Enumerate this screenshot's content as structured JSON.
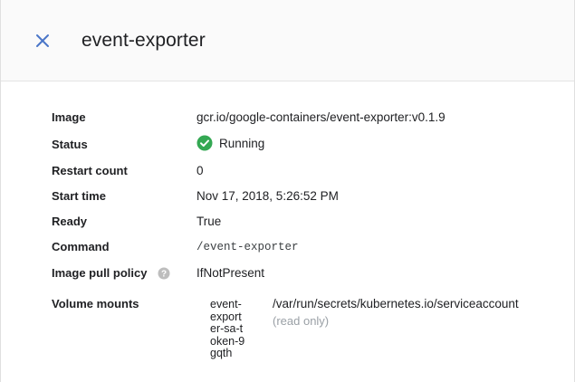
{
  "panel": {
    "title": "event-exporter",
    "close_icon": "close-icon"
  },
  "details": {
    "image": {
      "label": "Image",
      "value": "gcr.io/google-containers/event-exporter:v0.1.9"
    },
    "status": {
      "label": "Status",
      "value": "Running",
      "icon": "check-circle-icon",
      "color": "#34a853"
    },
    "restart_count": {
      "label": "Restart count",
      "value": "0"
    },
    "start_time": {
      "label": "Start time",
      "value": "Nov 17, 2018, 5:26:52 PM"
    },
    "ready": {
      "label": "Ready",
      "value": "True"
    },
    "command": {
      "label": "Command",
      "value": "/event-exporter"
    },
    "image_pull_policy": {
      "label": "Image pull policy",
      "value": "IfNotPresent",
      "help_icon": "help-icon"
    },
    "volume_mounts": {
      "label": "Volume mounts",
      "name_lines": [
        "event-",
        "export",
        "er-sa-t",
        "oken-9",
        "gqth"
      ],
      "path": "/var/run/secrets/kubernetes.io/serviceaccount",
      "note": "(read only)"
    }
  },
  "colors": {
    "accent": "#4285f4",
    "success": "#34a853",
    "muted": "#9aa0a6"
  }
}
